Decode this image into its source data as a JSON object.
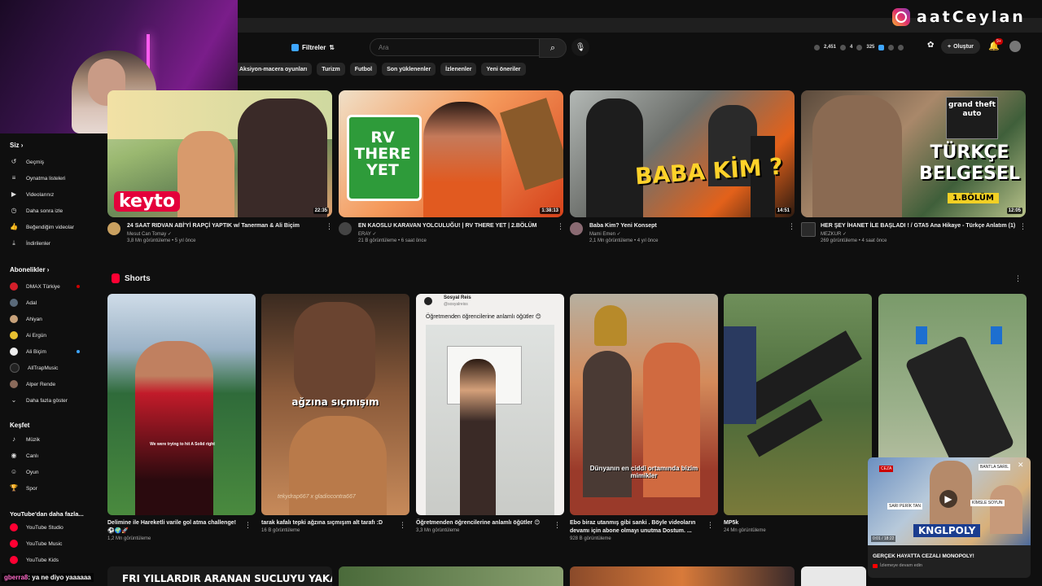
{
  "overlay": {
    "instagram_handle": "aatCeylan",
    "chat_user": "gberra8",
    "chat_message": ": ya ne diyo yaaaaaa"
  },
  "header": {
    "filters_label": "Filtreler",
    "search_placeholder": "Ara",
    "stats": [
      "2,451",
      "4",
      "325"
    ],
    "create_label": "Oluştur",
    "notification_count": "9+"
  },
  "chips": [
    "Aksiyon-macera oyunları",
    "Turizm",
    "Futbol",
    "Son yüklenenler",
    "İzlenenler",
    "Yeni öneriler"
  ],
  "sidebar": {
    "you_title": "Siz",
    "you_items": [
      "Geçmiş",
      "Oynatma listeleri",
      "Videolarınız",
      "Daha sonra izle",
      "Beğendiğim videolar",
      "İndirilenler"
    ],
    "subs_title": "Abonelikler",
    "subs": [
      "DMAX Türkiye",
      "Adal",
      "Ahiyan",
      "Ai Ergün",
      "Ali Biçim",
      "AllTrapMusic",
      "Alper Rende"
    ],
    "subs_more": "Daha fazla göster",
    "explore_title": "Keşfet",
    "explore_items": [
      "Müzik",
      "Canlı",
      "Oyun",
      "Spor"
    ],
    "more_title": "YouTube'dan daha fazla...",
    "more_items": [
      "YouTube Studio",
      "YouTube Music",
      "YouTube Kids"
    ]
  },
  "videos": [
    {
      "title": "24 SAAT RIDVAN ABİ'Yİ RAPÇİ YAPTIK w/ Tanerman & Ali Biçim",
      "channel": "Mesut Can Tomay",
      "meta": "3,8 Mn görüntüleme • 5 yıl önce",
      "duration": "22:35",
      "thumb_text": "keyto"
    },
    {
      "title": "EN KAOSLU KARAVAN YOLCULUĞU! | RV THERE YET | 2.BÖLÜM",
      "channel": "ERAY",
      "meta": "21 B görüntüleme • 6 saat önce",
      "duration": "1:38:13",
      "thumb_text": "RV THERE YET"
    },
    {
      "title": "Baba Kim? Yeni Konsept",
      "channel": "Mami Emen",
      "meta": "2,1 Mn görüntüleme • 4 yıl önce",
      "duration": "14:51",
      "thumb_text": "BABA KİM ?"
    },
    {
      "title": "HER ŞEY İHANET İLE BAŞLADI ! / GTA5 Ana Hikaye - Türkçe Anlatım (1)",
      "channel": "MEZKUR",
      "meta": "269 görüntüleme • 4 saat önce",
      "duration": "12:05",
      "thumb_text": "TÜRKÇE BELGESEL",
      "thumb_sub": "1.BÖLÜM",
      "thumb_logo": "grand theft auto"
    }
  ],
  "shorts_title": "Shorts",
  "shorts": [
    {
      "title": "Delimine ile Hareketli varile gol atma challenge!⚽🌍🚀",
      "views": "1,2 Mn görüntüleme",
      "caption": "We were trying to hit A Solid right"
    },
    {
      "title": "tarak kafalı tepki ağzına sıçmışım alt tarafı :D",
      "views": "16 B görüntüleme",
      "caption": "ağzına sıçmışım",
      "watermark": "tekydrap667 x gladiocontra667"
    },
    {
      "title": "Öğretmenden öğrencilerine anlamlı öğütler 😊",
      "views": "3,3 Mn görüntüleme",
      "caption_user": "Sosyal Reis",
      "caption_handle": "@sosyalreiss",
      "caption": "Öğretmenden öğrencilerine anlamlı öğütler 😊"
    },
    {
      "title": "Ebo biraz utanmış gibi sanki . Böyle videoların devamı için abone olmayı unutma Dostum. ...",
      "views": "928 B görüntüleme",
      "caption": "Dünyanın en ciddi ortamında bizim mimikler"
    },
    {
      "title": "MP5k",
      "views": "24 Mn görüntüleme"
    },
    {
      "title": "",
      "views": ""
    }
  ],
  "bottom_row_text": "FRI YILLARDIR ARANAN SUCLUYU YAKALADI",
  "miniplayer": {
    "title": "GERÇEK HAYATTA CEZALI MONOPOLY!",
    "subtitle": "İzlemeye devam edin",
    "time": "0:01 / 18:22",
    "banner": "KNGLPOLY",
    "tags": [
      "CEZA",
      "SARI PERİK TAN",
      "BANTLA SARIL",
      "KİMSLE SOYUN"
    ]
  },
  "colors": {
    "bg": "#0f0f0f",
    "accent": "#ff0033",
    "link": "#3ea6ff"
  }
}
